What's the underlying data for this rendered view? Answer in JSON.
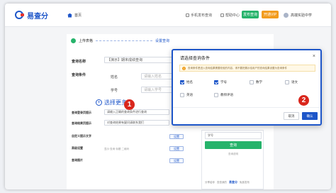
{
  "app": {
    "logo_text": "易查分"
  },
  "topbar": {
    "home": "首页",
    "links": [
      "手机发布查询",
      "帮助中心"
    ],
    "btn_green": "发布查询",
    "btn_orange": "开通VIP",
    "user": "高端实验中学"
  },
  "steps": {
    "step1": "上传表格",
    "step2": "设置查询"
  },
  "form": {
    "query_name_label": "查询名称",
    "query_name_value": "【演示】期末成绩查询",
    "condition_label": "查询条件",
    "conditions": [
      {
        "label": "姓名",
        "placeholder": "请输入姓名"
      },
      {
        "label": "学号",
        "placeholder": "请输入学号"
      }
    ],
    "add_more": "选择更多",
    "extra_rows": [
      {
        "label": "查询登录页提示",
        "value": "请输入正确的查询条件进行查询"
      },
      {
        "label": "查询结果页提示",
        "value": "对查询结果有疑问请联系我们"
      },
      {
        "label": "自定义提示文字"
      },
      {
        "label": "高级设置",
        "hint": "显示·查询·标题·二维码",
        "button": "设置"
      },
      {
        "label": "查询图片",
        "button": "设置"
      }
    ],
    "extra_button": "设置"
  },
  "preview": {
    "field": "学号",
    "button": "查询",
    "hint": "查询说明",
    "footer_links": [
      "分享给你",
      "查查我的"
    ],
    "brand": "易查分",
    "footer_tail": "免费发布"
  },
  "modal": {
    "title": "请选择查询条件",
    "close": "×",
    "notice": "查询条件是进入查询结果需要校验的内容，请不要把展示给用户的查询结果设置为查询条件",
    "options": [
      {
        "label": "姓名",
        "checked": true
      },
      {
        "label": "学号",
        "checked": true
      },
      {
        "label": "数学",
        "checked": false
      },
      {
        "label": "语文",
        "checked": false
      },
      {
        "label": "英语",
        "checked": false
      },
      {
        "label": "教师评语",
        "checked": false
      }
    ],
    "cancel": "取消",
    "confirm": "确认"
  },
  "badges": [
    "1",
    "2"
  ],
  "colors": {
    "primary": "#1e56c9",
    "green": "#26b36b",
    "orange": "#f29c1f",
    "badge": "#d9261c"
  }
}
